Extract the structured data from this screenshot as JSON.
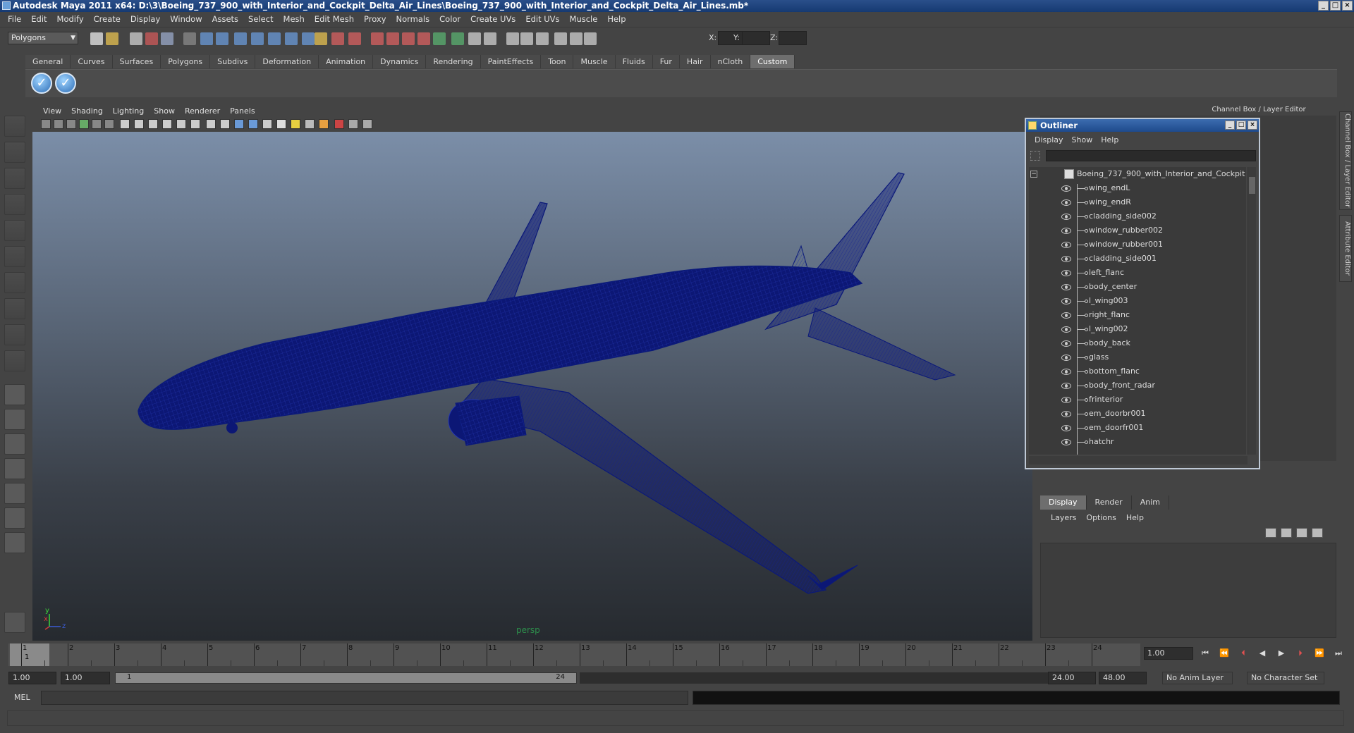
{
  "title": "Autodesk Maya 2011 x64: D:\\3\\Boeing_737_900_with_Interior_and_Cockpit_Delta_Air_Lines\\Boeing_737_900_with_Interior_and_Cockpit_Delta_Air_Lines.mb*",
  "window_buttons": [
    "_",
    "□",
    "×"
  ],
  "menubar": [
    "File",
    "Edit",
    "Modify",
    "Create",
    "Display",
    "Window",
    "Assets",
    "Select",
    "Mesh",
    "Edit Mesh",
    "Proxy",
    "Normals",
    "Color",
    "Create UVs",
    "Edit UVs",
    "Muscle",
    "Help"
  ],
  "mode_selector": "Polygons",
  "coord_labels": {
    "x": "X:",
    "y": "Y:",
    "z": "Z:"
  },
  "shelf_tabs": [
    "General",
    "Curves",
    "Surfaces",
    "Polygons",
    "Subdivs",
    "Deformation",
    "Animation",
    "Dynamics",
    "Rendering",
    "PaintEffects",
    "Toon",
    "Muscle",
    "Fluids",
    "Fur",
    "Hair",
    "nCloth",
    "Custom"
  ],
  "shelf_active": "Custom",
  "viewport_menu": [
    "View",
    "Shading",
    "Lighting",
    "Show",
    "Renderer",
    "Panels"
  ],
  "camera_label": "persp",
  "axis": {
    "x": "x",
    "y": "y",
    "z": "z",
    "x_color": "#d43b3b",
    "y_color": "#3bd43b",
    "z_color": "#3b5bd4"
  },
  "wire_color": "#0b1a7a",
  "channel_box_header": "Channel Box / Layer Editor",
  "side_tabs": [
    "Channel Box / Layer Editor",
    "Attribute Editor"
  ],
  "outliner": {
    "title": "Outliner",
    "menu": [
      "Display",
      "Show",
      "Help"
    ],
    "root": "Boeing_737_900_with_Interior_and_Cockpit",
    "collapse": "−",
    "items": [
      "wing_endL",
      "wing_endR",
      "cladding_side002",
      "window_rubber002",
      "window_rubber001",
      "cladding_side001",
      "left_flanc",
      "body_center",
      "l_wing003",
      "right_flanc",
      "l_wing002",
      "body_back",
      "glass",
      "bottom_flanc",
      "body_front_radar",
      "frinterior",
      "em_doorbr001",
      "em_doorfr001",
      "hatchr"
    ]
  },
  "layer_tabs": [
    "Display",
    "Render",
    "Anim"
  ],
  "layer_active": "Display",
  "layer_menu": [
    "Layers",
    "Options",
    "Help"
  ],
  "timeline": {
    "ticks": [
      "1",
      "2",
      "3",
      "4",
      "5",
      "6",
      "7",
      "8",
      "9",
      "10",
      "11",
      "12",
      "13",
      "14",
      "15",
      "16",
      "17",
      "18",
      "19",
      "20",
      "21",
      "22",
      "23",
      "24"
    ],
    "current": "1",
    "current_field": "1.00"
  },
  "playback_buttons": [
    "⏮",
    "⏪",
    "⏴",
    "◀",
    "▶",
    "⏵",
    "⏩",
    "⏭"
  ],
  "range": {
    "start": "1.00",
    "start2": "1.00",
    "slider_start": "1",
    "slider_end": "24",
    "end": "24.00",
    "end2": "48.00",
    "anim_layer": "No Anim Layer",
    "char_set": "No Character Set"
  },
  "mel_label": "MEL"
}
